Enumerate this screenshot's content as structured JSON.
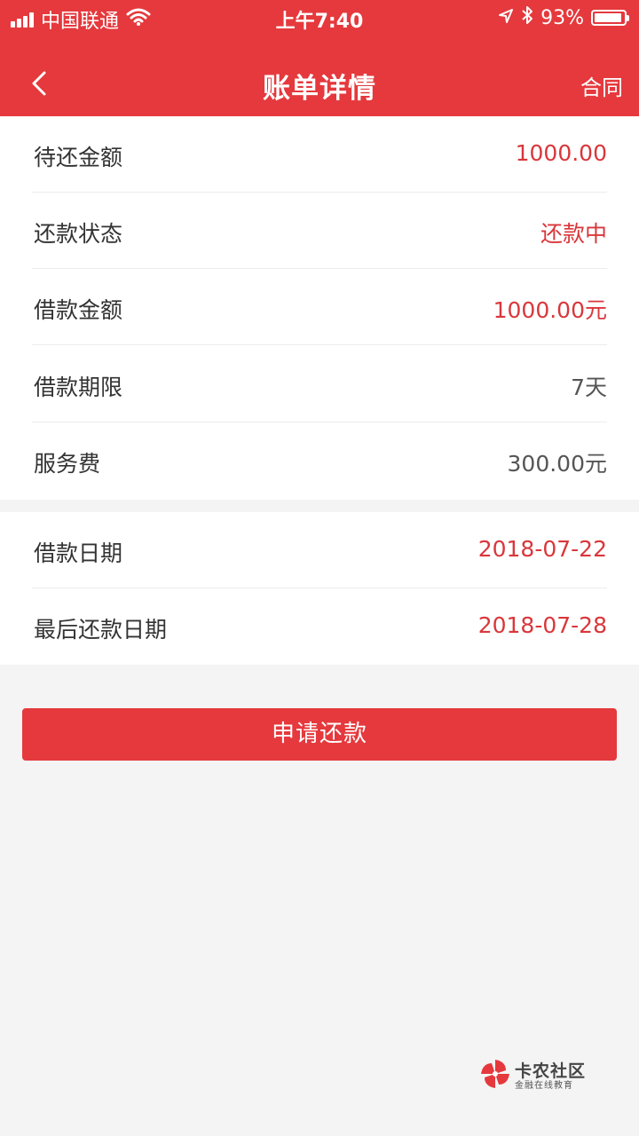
{
  "status_bar": {
    "carrier": "中国联通",
    "time": "上午7:40",
    "battery_percent": "93%",
    "battery_level": 0.93,
    "icons": [
      "signal-icon",
      "wifi-icon",
      "location-arrow-icon",
      "bluetooth-icon",
      "battery-icon"
    ]
  },
  "nav": {
    "title": "账单详情",
    "contract_label": "合同",
    "back_icon": "chevron-left-icon"
  },
  "details": [
    {
      "label": "待还金额",
      "value": "1000.00"
    },
    {
      "label": "还款状态",
      "value": "还款中"
    },
    {
      "label": "借款金额",
      "value": "1000.00元"
    },
    {
      "label": "借款期限",
      "value": "7天"
    },
    {
      "label": "服务费",
      "value": "300.00元"
    }
  ],
  "dates": [
    {
      "label": "借款日期",
      "value": "2018-07-22"
    },
    {
      "label": "最后还款日期",
      "value": "2018-07-28"
    }
  ],
  "action": {
    "apply_label": "申请还款"
  },
  "watermark": {
    "brand": "卡农社区",
    "subtitle": "金融在线教育"
  },
  "colors": {
    "accent": "#e5393d",
    "value_red": "#d9373b",
    "background": "#f4f4f4"
  }
}
